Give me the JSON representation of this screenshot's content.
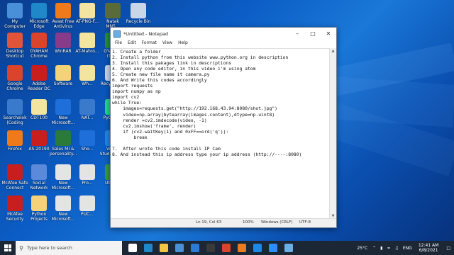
{
  "desktop": {
    "icons": [
      {
        "label": "My Computer",
        "color": "#4a90d9"
      },
      {
        "label": "Microsoft Edge",
        "color": "#1e88c8"
      },
      {
        "label": "Avast Free Antivirus",
        "color": "#f07a1a"
      },
      {
        "label": "AT-PNG-F...",
        "color": "#f4e4a0"
      },
      {
        "label": "Natak MN5...",
        "color": "#5a6b3a"
      },
      {
        "label": "Recycle Bin",
        "color": "#c8d6e8"
      },
      {
        "label": "Desktop Shortcut",
        "color": "#e0543a"
      },
      {
        "label": "GYAHAM Chrome",
        "color": "#d9442a"
      },
      {
        "label": "WinRAR",
        "color": "#8a3a8a"
      },
      {
        "label": "AT-Mahro...",
        "color": "#f4e4a0"
      },
      {
        "label": "GYAHAM (Test)",
        "color": "#2a8a3a"
      },
      {
        "label": "Google Chrome",
        "color": "#d9442a"
      },
      {
        "label": "Adobe Reader DC",
        "color": "#c81e1e"
      },
      {
        "label": "Software",
        "color": "#f4d27a"
      },
      {
        "label": "Wh...",
        "color": "#f4e4a0"
      },
      {
        "label": "Recycle Bin",
        "color": "#c8d6e8"
      },
      {
        "label": "Searchelok (Coding Wi...",
        "color": "#3a7acc"
      },
      {
        "label": "CDT100",
        "color": "#f4e4a0"
      },
      {
        "label": "New Microsoft...",
        "color": "#1e6fd9"
      },
      {
        "label": "NAT...",
        "color": "#3a7acc"
      },
      {
        "label": "PyCharm",
        "color": "#21d789"
      },
      {
        "label": "Firefox",
        "color": "#f07a1a"
      },
      {
        "label": "AS-20190",
        "color": "#c81e1e"
      },
      {
        "label": "Sales MI & personality...",
        "color": "#2a7a3a"
      },
      {
        "label": "Sho...",
        "color": "#1e6fd9"
      },
      {
        "label": "Visual Studio Code",
        "color": "#1e88e5"
      },
      {
        "label": "McAfee Safe Connect",
        "color": "#c81e1e"
      },
      {
        "label": "Social Network",
        "color": "#5a8ad9"
      },
      {
        "label": "New Microsoft...",
        "color": "#e4e4e4"
      },
      {
        "label": "Pro...",
        "color": "#e4e4e4"
      },
      {
        "label": "Ubuntu",
        "color": "#3a9a3a"
      },
      {
        "label": "McAfee Security Scan",
        "color": "#c81e1e"
      },
      {
        "label": "Python Projects",
        "color": "#f4d27a"
      },
      {
        "label": "New Microsoft...",
        "color": "#e4e4e4"
      },
      {
        "label": "PUC...",
        "color": "#e4e4e4"
      }
    ]
  },
  "notepad": {
    "title": "*Untitled - Notepad",
    "menu": [
      "File",
      "Edit",
      "Format",
      "View",
      "Help"
    ],
    "lines": [
      "1. Create a folder",
      "2. Install python from this website www.python.org in description",
      "3. Install this pakages link in descriptions",
      "4. Open any code editor, in this video i'm using atom",
      "5. Create new file name it camera.py",
      "6. And Write this codes accordingly",
      "import requests",
      "import numpy as np",
      "import cv2",
      "while True:",
      "    images=requests.get(\"http://192.168.43.94:8080/shot.jpg\")",
      "    video=np.array(bytearray(images.content),dtype=np.uint8)",
      "    render =cv2.imdecode(video, -1)",
      "    cv2.imshow('frame', render)",
      "    if (cv2.waitKey(1) and 0xFF==ord('q')):",
      "        break",
      "",
      "7.  After wrote this code install IP Cam",
      "8. And instead this ip address type your ip address (http://----:8080)"
    ],
    "status": {
      "position": "Ln 19, Col 63",
      "zoom": "100%",
      "line_ending": "Windows (CRLF)",
      "encoding": "UTF-8"
    }
  },
  "taskbar": {
    "search_placeholder": "Type here to search",
    "apps": [
      {
        "name": "task-view",
        "color": "#ffffff"
      },
      {
        "name": "edge",
        "color": "#1e88c8"
      },
      {
        "name": "file-explorer",
        "color": "#f4c542"
      },
      {
        "name": "store",
        "color": "#4a90d9"
      },
      {
        "name": "mail",
        "color": "#2a7ad9"
      },
      {
        "name": "camera",
        "color": "#3a3a3a"
      },
      {
        "name": "chrome",
        "color": "#d9442a"
      },
      {
        "name": "firefox",
        "color": "#f07a1a"
      },
      {
        "name": "vscode",
        "color": "#1e88e5"
      },
      {
        "name": "zoom",
        "color": "#2d8cff"
      },
      {
        "name": "notepad",
        "color": "#6ab0e6"
      }
    ],
    "weather": "25°C",
    "language": "ENG",
    "time": "12:41 AM",
    "date": "6/8/2021"
  }
}
